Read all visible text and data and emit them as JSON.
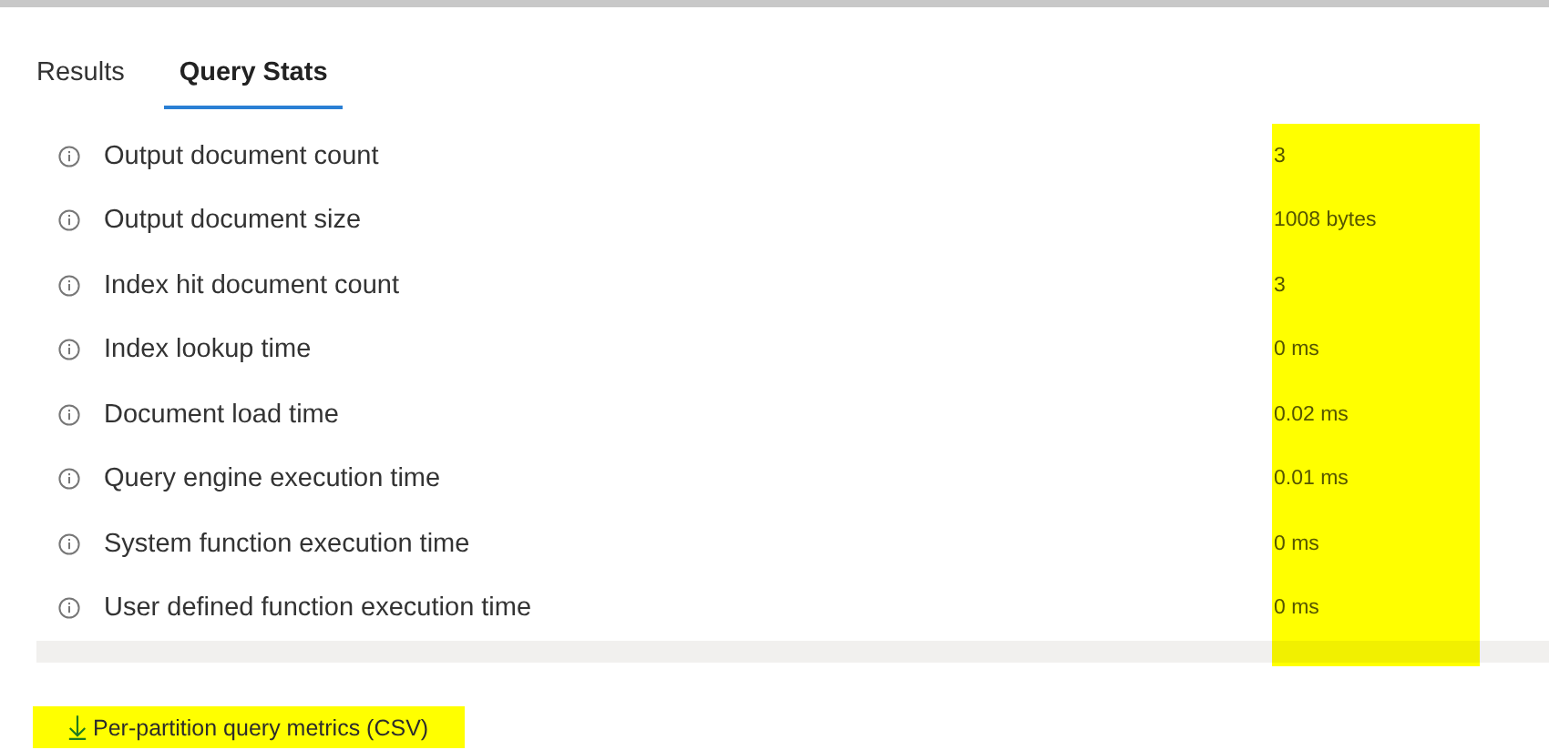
{
  "tabs": [
    {
      "label": "Results",
      "selected": false
    },
    {
      "label": "Query Stats",
      "selected": true
    }
  ],
  "stats": {
    "values_highlighted": true,
    "rows": [
      {
        "label": "Output document count",
        "value": "3"
      },
      {
        "label": "Output document size",
        "value": "1008 bytes"
      },
      {
        "label": "Index hit document count",
        "value": "3"
      },
      {
        "label": "Index lookup time",
        "value": "0 ms"
      },
      {
        "label": "Document load time",
        "value": "0.02 ms"
      },
      {
        "label": "Query engine execution time",
        "value": "0.01 ms"
      },
      {
        "label": "System function execution time",
        "value": "0 ms"
      },
      {
        "label": "User defined function execution time",
        "value": "0 ms"
      }
    ]
  },
  "download": {
    "label": "Per-partition query metrics (CSV)",
    "highlighted": true
  }
}
